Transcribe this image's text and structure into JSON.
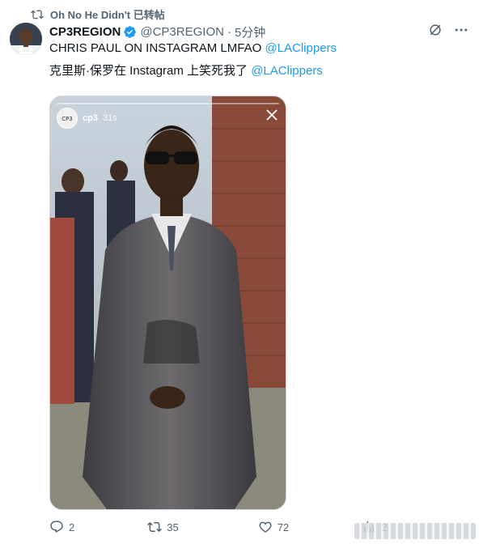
{
  "retweet": {
    "icon": "retweet-icon",
    "text": "Oh No He Didn't 已转帖"
  },
  "tweet": {
    "display_name": "CP3REGION",
    "handle": "@CP3REGION",
    "separator": "·",
    "time": "5分钟",
    "line1_text": "CHRIS PAUL ON INSTAGRAM LMFAO ",
    "line1_mention": "@LAClippers",
    "line2_text": "克里斯·保罗在 Instagram 上笑死我了 ",
    "line2_mention": "@LAClippers",
    "verified_color": "#1d9bf0"
  },
  "story": {
    "username": "cp3",
    "time": "31s"
  },
  "actions": {
    "reply_count": "2",
    "retweet_count": "35",
    "like_count": "72",
    "views_count": "2"
  },
  "colors": {
    "accent": "#1d9bf0",
    "muted": "#536471",
    "text": "#0f1419"
  }
}
